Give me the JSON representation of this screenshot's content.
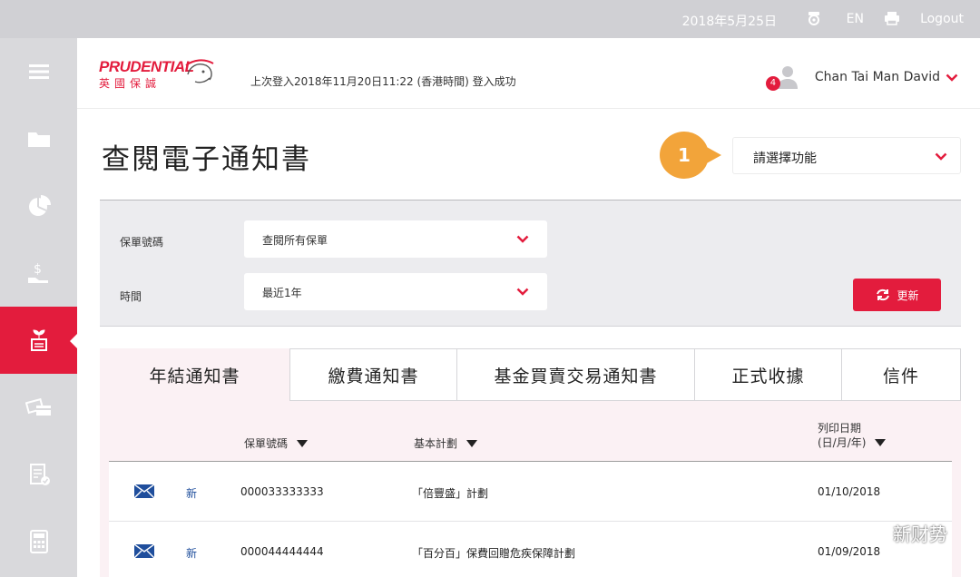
{
  "topbar": {
    "date": "2018年5月25日",
    "lang": "EN",
    "logout": "Logout",
    "icons": [
      "notification-icon",
      "printer-icon"
    ]
  },
  "sidebar": {
    "items": [
      {
        "icon": "menu-icon"
      },
      {
        "icon": "folder-icon"
      },
      {
        "icon": "pie-chart-icon"
      },
      {
        "icon": "money-hand-icon"
      },
      {
        "icon": "plant-document-icon",
        "active": true
      },
      {
        "icon": "cash-card-icon"
      },
      {
        "icon": "document-check-icon"
      },
      {
        "icon": "calculator-icon"
      }
    ]
  },
  "header": {
    "brand": "PRUDENTIAL",
    "brand_cn": "英國保誠",
    "last_login": "上次登入2018年11月20日11:22 (香港時間) 登入成功",
    "user_name": "Chan Tai Man David",
    "notification_count": "4"
  },
  "page": {
    "title": "查閱電子通知書",
    "step_number": "1",
    "function_select": "請選擇功能"
  },
  "filters": {
    "policy_label": "保單號碼",
    "policy_value": "查閱所有保單",
    "time_label": "時間",
    "time_value": "最近1年",
    "refresh_label": "更新"
  },
  "tabs": [
    {
      "label": "年結通知書",
      "active": true
    },
    {
      "label": "繳費通知書"
    },
    {
      "label": "基金買賣交易通知書"
    },
    {
      "label": "正式收據"
    },
    {
      "label": "信件"
    }
  ],
  "table": {
    "columns": {
      "policy_no": "保單號碼",
      "plan": "基本計劃",
      "print_date_line1": "列印日期",
      "print_date_line2": "(日/月/年)"
    },
    "rows": [
      {
        "status": "新",
        "policy_no": "000033333333",
        "plan": "「倍豐盛」計劃",
        "date": "01/10/2018"
      },
      {
        "status": "新",
        "policy_no": "000044444444",
        "plan": "「百分百」保費回贈危疾保障計劃",
        "date": "01/09/2018"
      }
    ]
  },
  "watermark": "新财势",
  "colors": {
    "brand_red": "#e31c3d",
    "step_orange": "#f2a43a",
    "sidebar_grey": "#d9d9dc"
  }
}
